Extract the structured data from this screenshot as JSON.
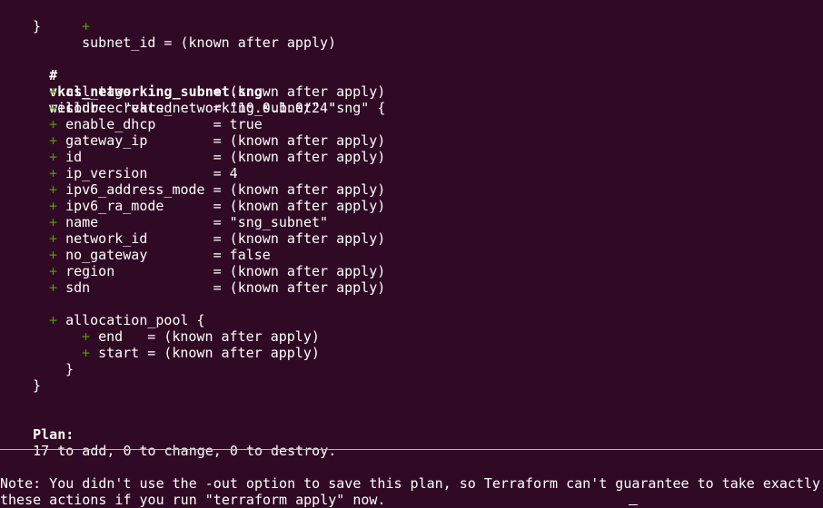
{
  "terminal": {
    "background": "#300a24",
    "foreground": "#ffffff",
    "plus_color": "#4e9a06",
    "lines": {
      "l1_attr": "subnet_id = (known after apply)",
      "l2_close": "}",
      "header_hash": "#",
      "header_name": "vkcs_networking_subnet.sng",
      "header_rest": "will be created",
      "resource_line": "resource \"vkcs_networking_subnet\" \"sng\" {",
      "attrs": [
        "all_tags          = (known after apply)",
        "cidr              = \"10.0.1.0/24\"",
        "enable_dhcp       = true",
        "gateway_ip        = (known after apply)",
        "id                = (known after apply)",
        "ip_version        = 4",
        "ipv6_address_mode = (known after apply)",
        "ipv6_ra_mode      = (known after apply)",
        "name              = \"sng_subnet\"",
        "network_id        = (known after apply)",
        "no_gateway        = false",
        "region            = (known after apply)",
        "sdn               = (known after apply)"
      ],
      "pool_open": "allocation_pool {",
      "pool_attrs": [
        "end   = (known after apply)",
        "start = (known after apply)"
      ],
      "pool_close": "}",
      "resource_close": "}",
      "plan_label": "Plan:",
      "plan_text": "17 to add, 0 to change, 0 to destroy.",
      "note_line1": "Note: You didn't use the -out option to save this plan, so Terraform can't guarantee to take exactly",
      "note_line2": "these actions if you run \"terraform apply\" now."
    },
    "plus_sign": "+"
  }
}
